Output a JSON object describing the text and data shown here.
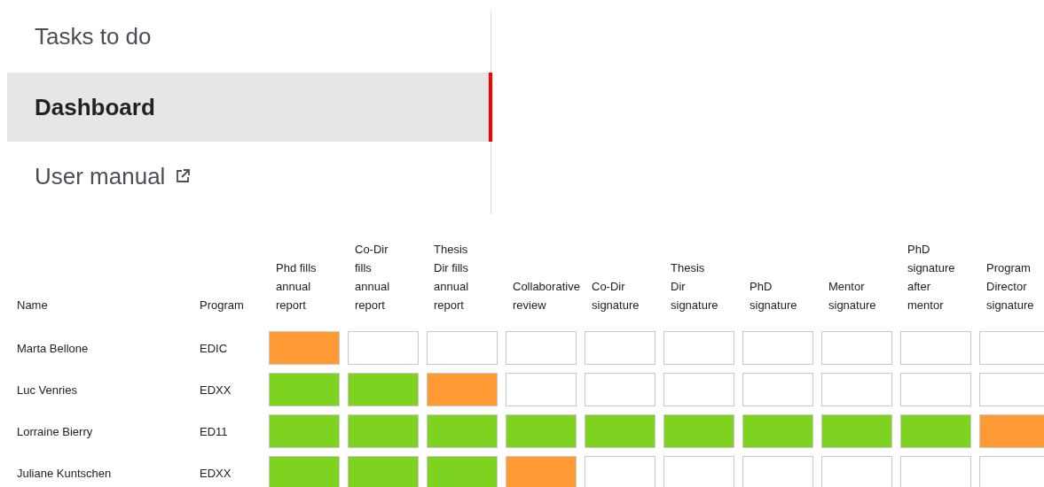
{
  "sidebar": {
    "items": [
      {
        "label": "Tasks to do",
        "selected": false,
        "external": false
      },
      {
        "label": "Dashboard",
        "selected": true,
        "external": false
      },
      {
        "label": "User manual",
        "selected": false,
        "external": true
      }
    ]
  },
  "table": {
    "columns": [
      "Name",
      "Program",
      "Phd fills annual report",
      "Co-Dir fills annual report",
      "Thesis Dir fills annual report",
      "Collaborative review",
      "Co-Dir signature",
      "Thesis Dir signature",
      "PhD signature",
      "Mentor signature",
      "PhD signature after mentor",
      "Program Director signature"
    ],
    "rows": [
      {
        "name": "Marta Bellone",
        "program": "EDIC",
        "steps": [
          {
            "color": "#ff9a35"
          },
          {
            "color": "#ffffff"
          },
          {
            "color": "#ffffff"
          },
          {
            "color": "#ffffff"
          },
          {
            "color": "#ffffff"
          },
          {
            "color": "#ffffff"
          },
          {
            "color": "#ffffff"
          },
          {
            "color": "#ffffff"
          },
          {
            "color": "#ffffff"
          },
          {
            "color": "#ffffff"
          }
        ]
      },
      {
        "name": "Luc Venries",
        "program": "EDXX",
        "steps": [
          {
            "color": "#7ed321"
          },
          {
            "color": "#7ed321"
          },
          {
            "color": "#ff9a35"
          },
          {
            "color": "#ffffff"
          },
          {
            "color": "#ffffff"
          },
          {
            "color": "#ffffff"
          },
          {
            "color": "#ffffff"
          },
          {
            "color": "#ffffff"
          },
          {
            "color": "#ffffff"
          },
          {
            "color": "#ffffff"
          }
        ]
      },
      {
        "name": "Lorraine Bierry",
        "program": "ED11",
        "steps": [
          {
            "color": "#7ed321"
          },
          {
            "color": "#7ed321"
          },
          {
            "color": "#7ed321"
          },
          {
            "color": "#7ed321"
          },
          {
            "color": "#7ed321"
          },
          {
            "color": "#7ed321"
          },
          {
            "color": "#7ed321"
          },
          {
            "color": "#7ed321"
          },
          {
            "color": "#7ed321"
          },
          {
            "color": "#ff9a35"
          }
        ]
      },
      {
        "name": "Juliane Kuntschen",
        "program": "EDXX",
        "steps": [
          {
            "color": "#7ed321"
          },
          {
            "color": "#7ed321"
          },
          {
            "color": "#7ed321"
          },
          {
            "color": "#ff9a35"
          },
          {
            "color": "#ffffff"
          },
          {
            "color": "#ffffff"
          },
          {
            "color": "#ffffff"
          },
          {
            "color": "#ffffff"
          },
          {
            "color": "#ffffff"
          },
          {
            "color": "#ffffff"
          }
        ]
      }
    ]
  }
}
